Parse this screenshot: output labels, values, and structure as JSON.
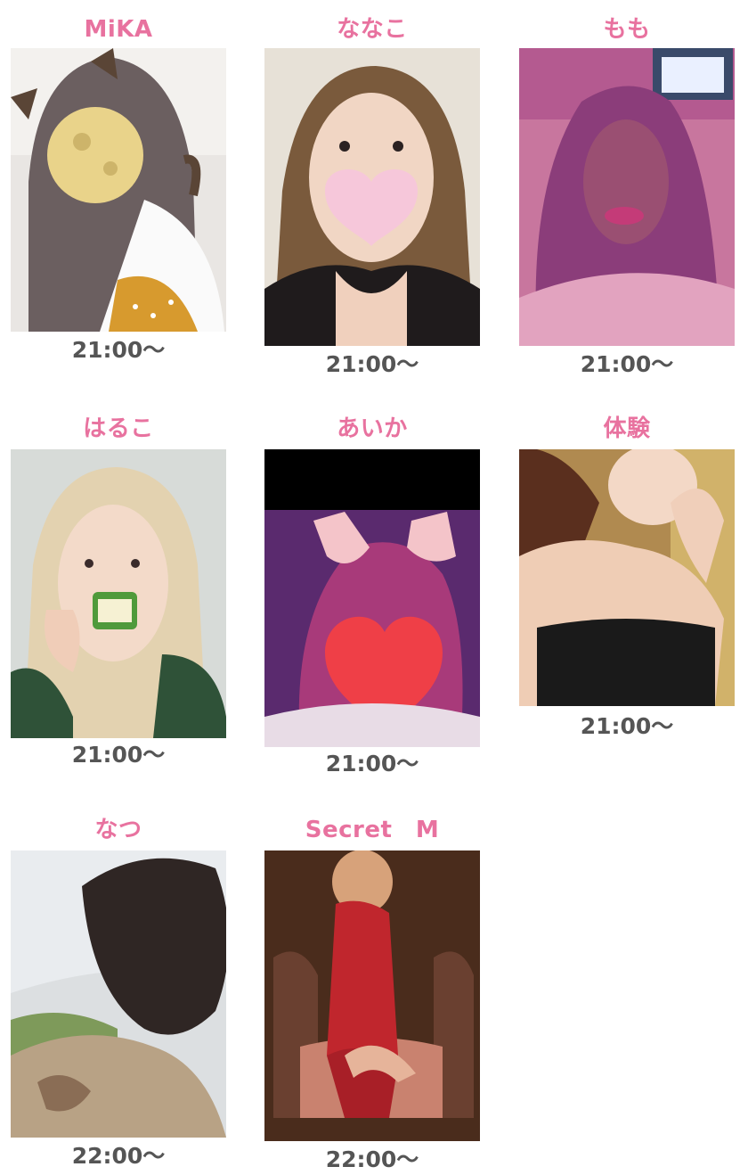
{
  "cast": [
    {
      "name": "MiKA",
      "time": "21:00〜"
    },
    {
      "name": "ななこ",
      "time": "21:00〜"
    },
    {
      "name": "もも",
      "time": "21:00〜"
    },
    {
      "name": "はるこ",
      "time": "21:00〜"
    },
    {
      "name": "あいか",
      "time": "21:00〜"
    },
    {
      "name": "体験",
      "time": "21:00〜"
    },
    {
      "name": "なつ",
      "time": "22:00〜"
    },
    {
      "name": "Secret　M",
      "time": "22:00〜"
    }
  ]
}
